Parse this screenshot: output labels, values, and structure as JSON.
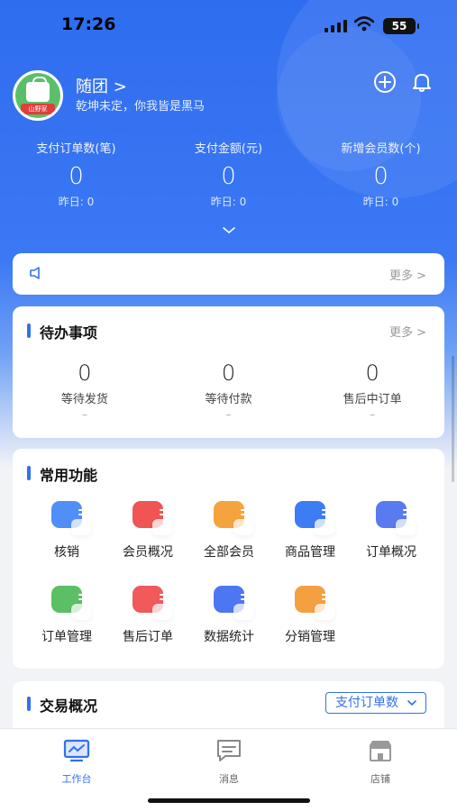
{
  "status_bar": {
    "time": "17:26",
    "battery": "55"
  },
  "shop": {
    "name": "随团 >",
    "slogan": "乾坤未定，你我皆是黑马",
    "avatar_text": "山野家"
  },
  "stats": [
    {
      "label": "支付订单数(笔)",
      "value": "0",
      "yesterday": "昨日: 0"
    },
    {
      "label": "支付金额(元)",
      "value": "0",
      "yesterday": "昨日: 0"
    },
    {
      "label": "新增会员数(个)",
      "value": "0",
      "yesterday": "昨日: 0"
    }
  ],
  "notice": {
    "more_label": "更多 >"
  },
  "todo": {
    "title": "待办事项",
    "more_label": "更多 >",
    "items": [
      {
        "value": "0",
        "label": "等待发货",
        "sub": "–"
      },
      {
        "value": "0",
        "label": "等待付款",
        "sub": "–"
      },
      {
        "value": "0",
        "label": "售后中订单",
        "sub": "–"
      }
    ]
  },
  "functions": {
    "title": "常用功能",
    "items": [
      {
        "label": "核销",
        "color": "#4f8ff7"
      },
      {
        "label": "会员概况",
        "color": "#f05454"
      },
      {
        "label": "全部会员",
        "color": "#f5a33c"
      },
      {
        "label": "商品管理",
        "color": "#3d7df3"
      },
      {
        "label": "订单概况",
        "color": "#5a7af0"
      },
      {
        "label": "订单管理",
        "color": "#5cbf63"
      },
      {
        "label": "售后订单",
        "color": "#f05a5a"
      },
      {
        "label": "数据统计",
        "color": "#4d77f2"
      },
      {
        "label": "分销管理",
        "color": "#f5a040"
      }
    ]
  },
  "trade": {
    "title": "交易概况",
    "dropdown_label": "支付订单数"
  },
  "tabbar": [
    {
      "label": "工作台",
      "icon": "workbench-icon",
      "active": true
    },
    {
      "label": "消息",
      "icon": "message-icon",
      "active": false
    },
    {
      "label": "店铺",
      "icon": "store-icon",
      "active": false
    }
  ],
  "colors": {
    "primary": "#3270f0",
    "hero": "#2f6df0"
  }
}
